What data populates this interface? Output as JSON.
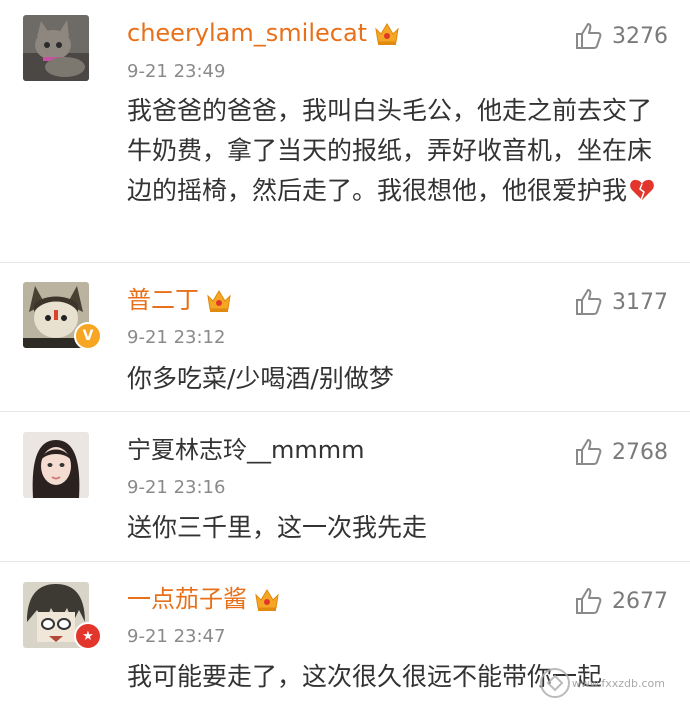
{
  "comments": [
    {
      "username": "cheerylam_smilecat",
      "vip": true,
      "timestamp": "9-21 23:49",
      "text": "我爸爸的爸爸，我叫白头毛公，他走之前去交了牛奶费，拿了当天的报纸，弄好收音机，坐在床边的摇椅，然后走了。我很想他，他很爱护我",
      "likes": "3276",
      "avatar": "cat-photo",
      "emoji": "broken-heart-icon"
    },
    {
      "username": "普二丁",
      "vip": true,
      "timestamp": "9-21 23:12",
      "text": "你多吃菜/少喝酒/别做梦",
      "likes": "3177",
      "avatar": "cartoon-character",
      "badge": "V"
    },
    {
      "username": "宁夏林志玲__mmmm",
      "vip": false,
      "timestamp": "9-21 23:16",
      "text": "送你三千里，这一次我先走",
      "likes": "2768",
      "avatar": "girl-selfie"
    },
    {
      "username": "一点茄子酱",
      "vip": true,
      "timestamp": "9-21 23:47",
      "text": "我可能要走了，这次很久很远不能带你一起",
      "likes": "2677",
      "avatar": "anime-character",
      "badge": "★"
    }
  ],
  "colors": {
    "vip_name": "#e8701a",
    "crown": "#f5a623",
    "timestamp": "#8a8a8a",
    "divider": "#e6e6e6",
    "v_badge": "#f6a623",
    "star_badge": "#e2362d"
  },
  "watermark": {
    "text": "www.fxxzdb.com"
  }
}
